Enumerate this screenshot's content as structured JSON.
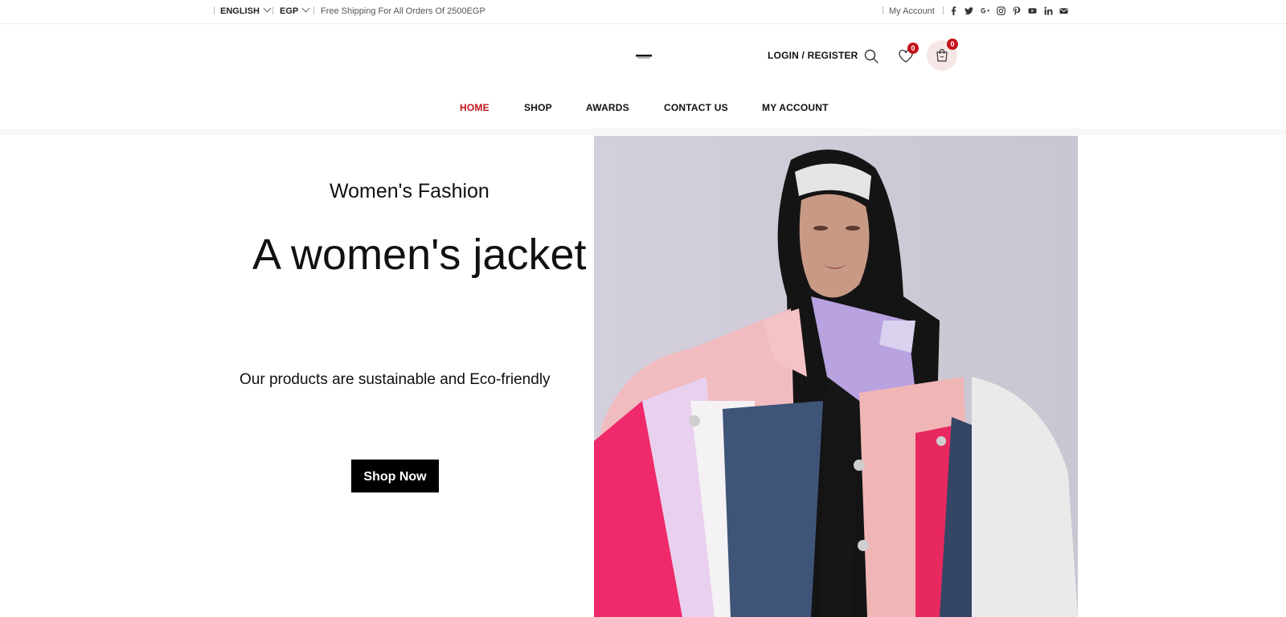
{
  "topbar": {
    "language": "ENGLISH",
    "currency": "EGP",
    "shipping_text": "Free Shipping For All Orders Of 2500EGP",
    "my_account": "My Account",
    "social_icons": [
      "facebook-icon",
      "twitter-icon",
      "google-plus-icon",
      "instagram-icon",
      "pinterest-icon",
      "youtube-icon",
      "linkedin-icon",
      "envelope-icon"
    ]
  },
  "header": {
    "login_register": "LOGIN / REGISTER",
    "wishlist_count": "0",
    "cart_count": "0",
    "icons": [
      "search-icon",
      "heart-icon",
      "shopping-bag-icon"
    ]
  },
  "nav": {
    "items": [
      "HOME",
      "SHOP",
      "AWARDS",
      "CONTACT US",
      "MY ACCOUNT"
    ],
    "active": "HOME"
  },
  "hero": {
    "subtitle": "Women's Fashion",
    "title": "A women's jacket",
    "description": "Our products are sustainable and Eco-friendly",
    "button": "Shop Now"
  },
  "colors": {
    "accent": "#c3111a",
    "cart_bg": "#f6e6e6",
    "button_bg": "#000000",
    "hero_bg": "#d7d5df"
  }
}
